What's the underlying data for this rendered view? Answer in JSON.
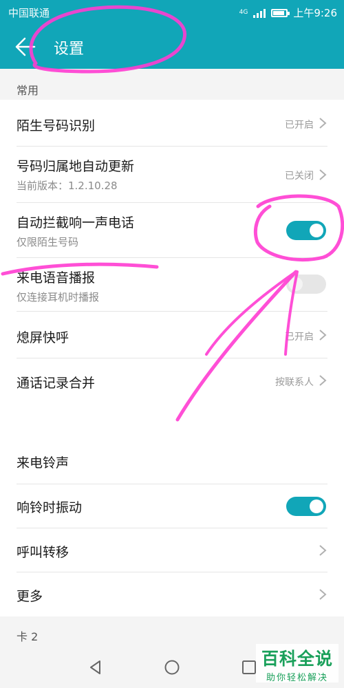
{
  "status_bar": {
    "carrier": "中国联通",
    "network": "4G",
    "time": "上午9:26"
  },
  "app_bar": {
    "back_icon": "back-arrow-icon",
    "title": "设置"
  },
  "sections": {
    "common": "常用",
    "ringtone": "来电铃声",
    "card2": "卡 2"
  },
  "rows": {
    "stranger_id": {
      "title": "陌生号码识别",
      "value": "已开启"
    },
    "location_update": {
      "title": "号码归属地自动更新",
      "subtitle": "当前版本：1.2.10.28",
      "value": "已关闭"
    },
    "block_one_ring": {
      "title": "自动拦截响一声电话",
      "subtitle": "仅限陌生号码",
      "enabled": true
    },
    "voice_announce": {
      "title": "来电语音播报",
      "subtitle": "仅连接耳机时播报",
      "enabled": false
    },
    "screen_off_call": {
      "title": "熄屏快呼",
      "value": "已开启"
    },
    "merge_logs": {
      "title": "通话记录合并",
      "value": "按联系人"
    },
    "vibrate_ring": {
      "title": "响铃时振动",
      "enabled": true
    },
    "call_forward": {
      "title": "呼叫转移"
    },
    "more": {
      "title": "更多"
    }
  },
  "nav_bar": {
    "back": "triangle-back-icon",
    "home": "circle-home-icon",
    "recents": "square-recents-icon"
  },
  "watermark": {
    "main": "百科全说",
    "sub": "助你轻松解决"
  },
  "colors": {
    "accent": "#11a6b8",
    "annotation": "#ff3cd2",
    "watermark": "#19a05a"
  }
}
